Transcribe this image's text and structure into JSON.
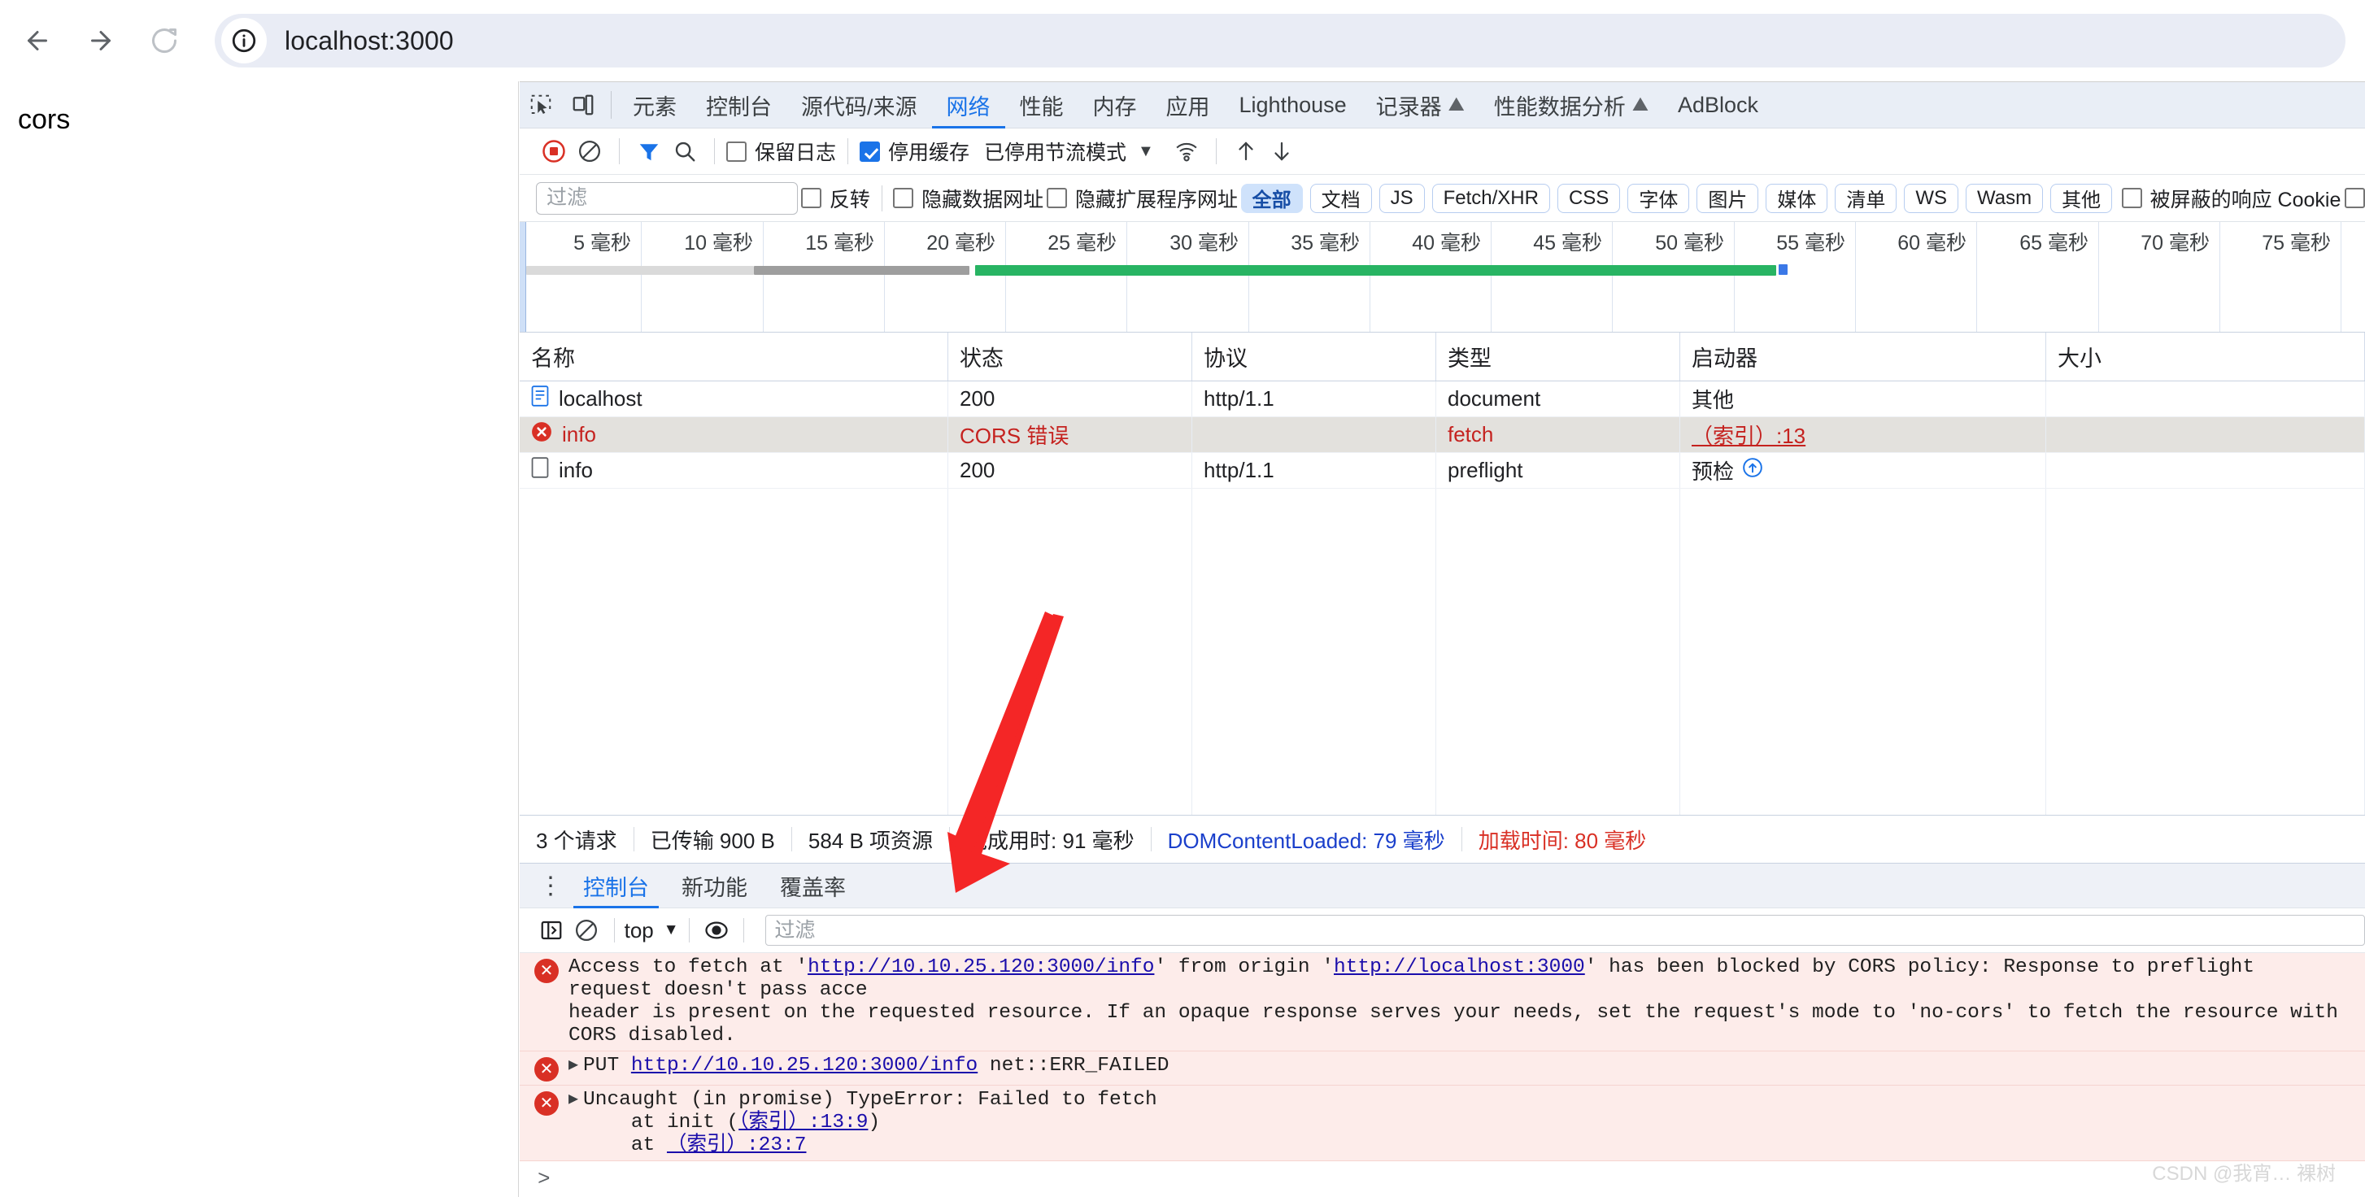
{
  "browser": {
    "back_label": "back-arrow",
    "forward_label": "forward-arrow",
    "reload_label": "reload",
    "url": "localhost:3000",
    "site_info_icon": "info-circle-icon"
  },
  "page": {
    "heading": "cors"
  },
  "devtools": {
    "tabs": [
      {
        "label": "元素",
        "active": false
      },
      {
        "label": "控制台",
        "active": false
      },
      {
        "label": "源代码/来源",
        "active": false
      },
      {
        "label": "网络",
        "active": true
      },
      {
        "label": "性能",
        "active": false
      },
      {
        "label": "内存",
        "active": false
      },
      {
        "label": "应用",
        "active": false
      },
      {
        "label": "Lighthouse",
        "active": false
      },
      {
        "label": "记录器",
        "active": false,
        "experimental": true
      },
      {
        "label": "性能数据分析",
        "active": false,
        "experimental": true
      },
      {
        "label": "AdBlock",
        "active": false
      }
    ],
    "network_toolbar": {
      "record_title": "record-stop-button",
      "clear_title": "clear-button",
      "filter_title": "filter-toggle",
      "search_title": "search-button",
      "preserve_log": {
        "label": "保留日志",
        "checked": false
      },
      "disable_cache": {
        "label": "停用缓存",
        "checked": true
      },
      "throttling": "已停用节流模式",
      "import_title": "import-har",
      "export_title": "export-har",
      "wifi_title": "network-conditions"
    },
    "filter_bar": {
      "filter_placeholder": "过滤",
      "filter_value": "",
      "invert": {
        "label": "反转",
        "checked": false
      },
      "hide_data_urls": {
        "label": "隐藏数据网址",
        "checked": false
      },
      "hide_ext_urls": {
        "label": "隐藏扩展程序网址",
        "checked": false
      },
      "type_chips": [
        {
          "label": "全部",
          "active": true
        },
        {
          "label": "文档",
          "active": false
        },
        {
          "label": "JS",
          "active": false
        },
        {
          "label": "Fetch/XHR",
          "active": false
        },
        {
          "label": "CSS",
          "active": false
        },
        {
          "label": "字体",
          "active": false
        },
        {
          "label": "图片",
          "active": false
        },
        {
          "label": "媒体",
          "active": false
        },
        {
          "label": "清单",
          "active": false
        },
        {
          "label": "WS",
          "active": false
        },
        {
          "label": "Wasm",
          "active": false
        },
        {
          "label": "其他",
          "active": false
        }
      ],
      "blocked_cookies": {
        "label": "被屏蔽的响应 Cookie",
        "checked": false
      },
      "extra_checkbox": {
        "label": "",
        "checked": false
      }
    },
    "overview": {
      "ticks": [
        "5 毫秒",
        "10 毫秒",
        "15 毫秒",
        "20 毫秒",
        "25 毫秒",
        "30 毫秒",
        "35 毫秒",
        "40 毫秒",
        "45 毫秒",
        "50 毫秒",
        "55 毫秒",
        "60 毫秒",
        "65 毫秒",
        "70 毫秒",
        "75 毫秒"
      ]
    },
    "table": {
      "columns": [
        "名称",
        "状态",
        "协议",
        "类型",
        "启动器",
        "大小"
      ],
      "rows": [
        {
          "icon": "document-icon",
          "name": "localhost",
          "status": "200",
          "protocol": "http/1.1",
          "type": "document",
          "initiator": "其他",
          "initiator_muted": true,
          "size": "",
          "error": false,
          "selected": false
        },
        {
          "icon": "error-icon",
          "name": "info",
          "status": "CORS 错误",
          "protocol": "",
          "type": "fetch",
          "initiator": "（索引）:13",
          "initiator_muted": false,
          "size": "",
          "error": true,
          "selected": true
        },
        {
          "icon": "blank-doc-icon",
          "name": "info",
          "status": "200",
          "protocol": "http/1.1",
          "type": "preflight",
          "initiator": "预检",
          "initiator_muted": false,
          "size": "",
          "error": false,
          "selected": false
        }
      ]
    },
    "summary": {
      "requests": "3 个请求",
      "transferred": "已传输 900 B",
      "resources": "584 B 项资源",
      "finish": "完成用时: 91 毫秒",
      "dom_content_loaded": "DOMContentLoaded: 79 毫秒",
      "load": "加载时间: 80 毫秒"
    },
    "drawer": {
      "tabs": [
        {
          "label": "控制台",
          "active": true
        },
        {
          "label": "新功能",
          "active": false
        },
        {
          "label": "覆盖率",
          "active": false
        }
      ],
      "console_toolbar": {
        "sidebar_title": "console-sidebar-toggle",
        "clear_title": "clear-console",
        "context": "top",
        "eye_title": "live-expression",
        "filter_placeholder": "过滤",
        "filter_value": ""
      },
      "messages": [
        {
          "kind": "cors-error",
          "line1_pre": "Access to fetch at '",
          "line1_link1": "http://10.10.25.120:3000/info",
          "line1_mid": "' from origin '",
          "line1_link2": "http://localhost:3000",
          "line1_post": "' has been blocked by CORS policy: Response to preflight request doesn't pass acce",
          "line2": "header is present on the requested resource. If an opaque response serves your needs, set the request's mode to 'no-cors' to fetch the resource with CORS disabled.",
          "expandable": false
        },
        {
          "kind": "net-error",
          "prefix": "PUT ",
          "link": "http://10.10.25.120:3000/info",
          "suffix": " net::ERR_FAILED",
          "expandable": true
        },
        {
          "kind": "uncaught",
          "title": "Uncaught (in promise) TypeError: Failed to fetch",
          "stack": [
            {
              "pre": "    at init (",
              "link": "（索引）:13:9",
              "post": ")"
            },
            {
              "pre": "    at ",
              "link": "（索引）:23:7",
              "post": ""
            }
          ],
          "expandable": true
        }
      ],
      "prompt_symbol": ">"
    }
  },
  "annotation": {
    "arrow_color": "#f42626"
  },
  "watermark": "CSDN @我宵… 裸树",
  "colors": {
    "accent_blue": "#1a73e8",
    "error_red": "#c5221f",
    "link_blue": "#1a0dab",
    "chip_active_bg": "#cfe2fb",
    "timeline_green": "#28b463",
    "selected_row": "#e3e1dd"
  }
}
